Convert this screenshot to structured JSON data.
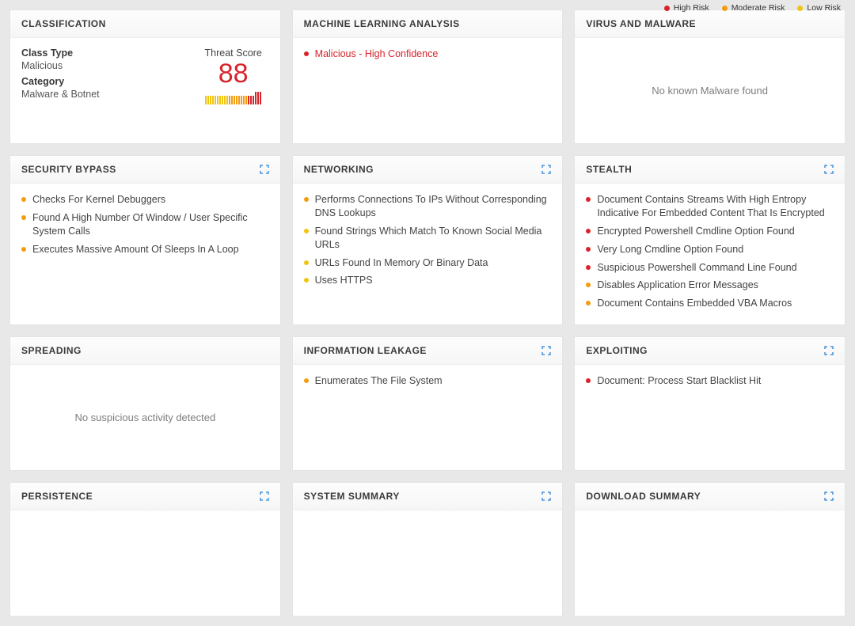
{
  "legend": {
    "high": "High Risk",
    "moderate": "Moderate Risk",
    "low": "Low Risk"
  },
  "colors": {
    "high": "#d8232a",
    "moderate": "#f39c12",
    "low": "#f1c40f"
  },
  "cards": {
    "classification": {
      "title": "CLASSIFICATION",
      "class_type_label": "Class Type",
      "class_type_value": "Malicious",
      "category_label": "Category",
      "category_value": "Malware & Botnet",
      "threat_score_label": "Threat Score",
      "threat_score_value": "88"
    },
    "ml": {
      "title": "MACHINE LEARNING ANALYSIS",
      "items": [
        {
          "text": "Malicious - High Confidence",
          "sev": "high",
          "red": true
        }
      ]
    },
    "virus": {
      "title": "VIRUS AND MALWARE",
      "empty": "No known Malware found"
    },
    "security_bypass": {
      "title": "SECURITY BYPASS",
      "items": [
        {
          "text": "Checks For Kernel Debuggers",
          "sev": "moderate"
        },
        {
          "text": "Found A High Number Of Window / User Specific System Calls",
          "sev": "moderate"
        },
        {
          "text": "Executes Massive Amount Of Sleeps In A Loop",
          "sev": "moderate"
        }
      ]
    },
    "networking": {
      "title": "NETWORKING",
      "items": [
        {
          "text": "Performs Connections To IPs Without Corresponding DNS Lookups",
          "sev": "moderate"
        },
        {
          "text": "Found Strings Which Match To Known Social Media URLs",
          "sev": "low"
        },
        {
          "text": "URLs Found In Memory Or Binary Data",
          "sev": "low"
        },
        {
          "text": "Uses HTTPS",
          "sev": "low"
        }
      ]
    },
    "stealth": {
      "title": "STEALTH",
      "items": [
        {
          "text": "Document Contains Streams With High Entropy Indicative For Embedded Content That Is Encrypted",
          "sev": "high"
        },
        {
          "text": "Encrypted Powershell Cmdline Option Found",
          "sev": "high"
        },
        {
          "text": "Very Long Cmdline Option Found",
          "sev": "high"
        },
        {
          "text": "Suspicious Powershell Command Line Found",
          "sev": "high"
        },
        {
          "text": "Disables Application Error Messages",
          "sev": "moderate"
        },
        {
          "text": "Document Contains Embedded VBA Macros",
          "sev": "moderate"
        }
      ]
    },
    "spreading": {
      "title": "SPREADING",
      "empty": "No suspicious activity detected"
    },
    "info_leak": {
      "title": "INFORMATION LEAKAGE",
      "items": [
        {
          "text": "Enumerates The File System",
          "sev": "moderate"
        }
      ]
    },
    "exploiting": {
      "title": "EXPLOITING",
      "items": [
        {
          "text": "Document: Process Start Blacklist Hit",
          "sev": "high"
        }
      ]
    },
    "persistence": {
      "title": "PERSISTENCE"
    },
    "system_summary": {
      "title": "SYSTEM SUMMARY"
    },
    "download_summary": {
      "title": "DOWNLOAD SUMMARY"
    }
  }
}
